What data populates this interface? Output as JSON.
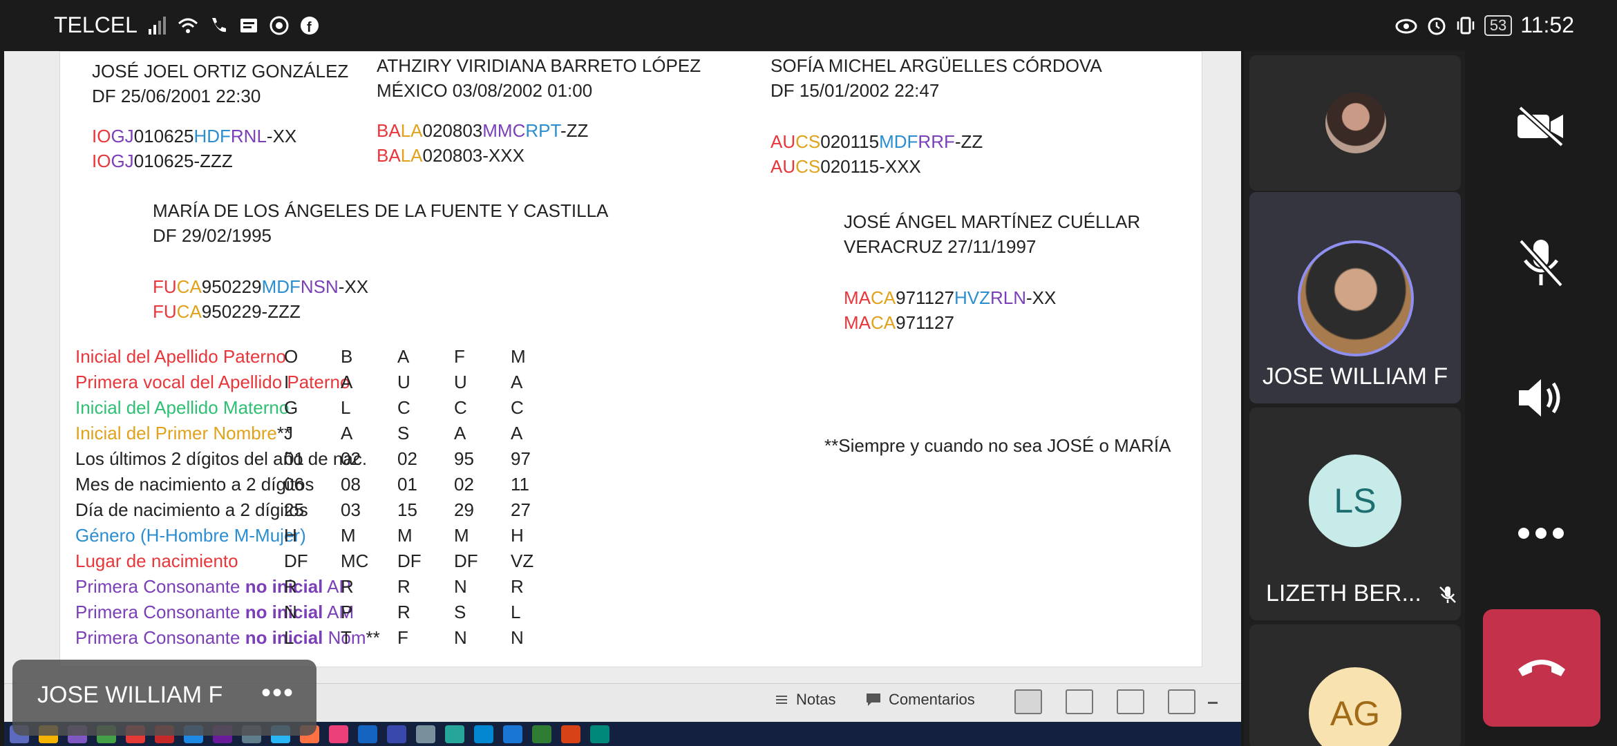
{
  "status_bar": {
    "carrier": "TELCEL",
    "battery": "53",
    "time": "11:52"
  },
  "slide": {
    "people": [
      {
        "name": "JOSÉ JOEL ORTIZ GONZÁLEZ",
        "place_date": "DF  25/06/2001  22:30",
        "code1": [
          "IO",
          "GJ",
          "010625",
          "HDF",
          "RNL",
          "-XX"
        ],
        "code2": [
          "IO",
          "GJ",
          "010625-ZZZ"
        ]
      },
      {
        "name": "ATHZIRY VIRIDIANA BARRETO LÓPEZ",
        "place_date": "MÉXICO  03/08/2002  01:00",
        "code1": [
          "BA",
          "LA",
          "020803",
          "MMC",
          "RPT",
          "-ZZ"
        ],
        "code2": [
          "BA",
          "LA",
          "020803-XXX"
        ]
      },
      {
        "name": "SOFÍA MICHEL ARGÜELLES CÓRDOVA",
        "place_date": "DF  15/01/2002  22:47",
        "code1": [
          "AU",
          "CS",
          "020115",
          "MDF",
          "RRF",
          "-ZZ"
        ],
        "code2": [
          "AU",
          "CS",
          "020115-XXX"
        ]
      },
      {
        "name": "MARÍA DE LOS ÁNGELES DE LA FUENTE Y CASTILLA",
        "place_date": "DF  29/02/1995",
        "code1": [
          "FU",
          "CA",
          "950229",
          "MDF",
          "NSN",
          "-XX"
        ],
        "code2": [
          "FU",
          "CA",
          "950229-ZZZ"
        ]
      },
      {
        "name": "JOSÉ ÁNGEL MARTÍNEZ CUÉLLAR",
        "place_date": "VERACRUZ  27/11/1997",
        "code1": [
          "MA",
          "CA",
          "971127",
          "HVZ",
          "RLN",
          "-XX"
        ],
        "code2": [
          "MA",
          "CA",
          "971127"
        ]
      }
    ],
    "rows": [
      {
        "label": "Inicial del Apellido Paterno",
        "values": [
          "O",
          "B",
          "A",
          "F",
          "M"
        ]
      },
      {
        "label": "Primera vocal del  Apellido Paterno",
        "values": [
          "I",
          "A",
          "U",
          "U",
          "A"
        ]
      },
      {
        "label": "Inicial del Apellido Materno",
        "values": [
          "G",
          "L",
          "C",
          "C",
          "C"
        ]
      },
      {
        "label": "Inicial del Primer Nombre",
        "suffix": "**",
        "values": [
          "J",
          "A",
          "S",
          "A",
          "A"
        ]
      },
      {
        "label": "Los últimos 2 dígitos del año de nac.",
        "values": [
          "01",
          "02",
          "02",
          "95",
          "97"
        ]
      },
      {
        "label": "Mes de nacimiento a 2 dígitos",
        "values": [
          "06",
          "08",
          "01",
          "02",
          "11"
        ]
      },
      {
        "label": "Día de nacimiento a 2 dígitos",
        "values": [
          "25",
          "03",
          "15",
          "29",
          "27"
        ]
      },
      {
        "label": "Género (H-Hombre M-Mujer)",
        "values": [
          "H",
          "M",
          "M",
          "M",
          "H"
        ]
      },
      {
        "label": "Lugar de nacimiento",
        "values": [
          "DF",
          "MC",
          "DF",
          "DF",
          "VZ"
        ]
      },
      {
        "label_pre": "Primera Consonante ",
        "label_bold": "no inicial",
        "label_post": " AP",
        "values": [
          "R",
          "R",
          "R",
          "N",
          "R"
        ]
      },
      {
        "label_pre": "Primera Consonante ",
        "label_bold": "no inicial",
        "label_post": " AM",
        "values": [
          "N",
          "P",
          "R",
          "S",
          "L"
        ]
      },
      {
        "label_pre": "Primera Consonante ",
        "label_bold": "no inicial",
        "label_post": " Nom",
        "suffix": "**",
        "values": [
          "L",
          "T",
          "F",
          "N",
          "N"
        ]
      }
    ],
    "note": "**Siempre y cuando no sea JOSÉ o MARÍA"
  },
  "ppt_toolbar": {
    "notes": "Notas",
    "comments": "Comentarios"
  },
  "presenter": {
    "name": "JOSE WILLIAM F",
    "more": "•••"
  },
  "participants": [
    {
      "name": ""
    },
    {
      "name": "JOSE WILLIAM F"
    },
    {
      "name": "LIZETH BER...",
      "initials": "LS"
    },
    {
      "name": "",
      "initials": "AG"
    }
  ],
  "colors": {
    "red": "#e8363a",
    "blue": "#2b8ed1",
    "purple": "#7b3fb8",
    "green": "#2fbf73",
    "yellow": "#e1a21b",
    "hangup": "#c4314b"
  },
  "icons": [
    "signal-icon",
    "wifi-icon",
    "phone-icon",
    "message-icon",
    "whatsapp-icon",
    "facebook-icon",
    "eye-icon",
    "alarm-icon",
    "vibrate-icon",
    "battery-icon",
    "camera-off-icon",
    "mic-off-icon",
    "speaker-icon",
    "more-icon",
    "hangup-icon"
  ]
}
